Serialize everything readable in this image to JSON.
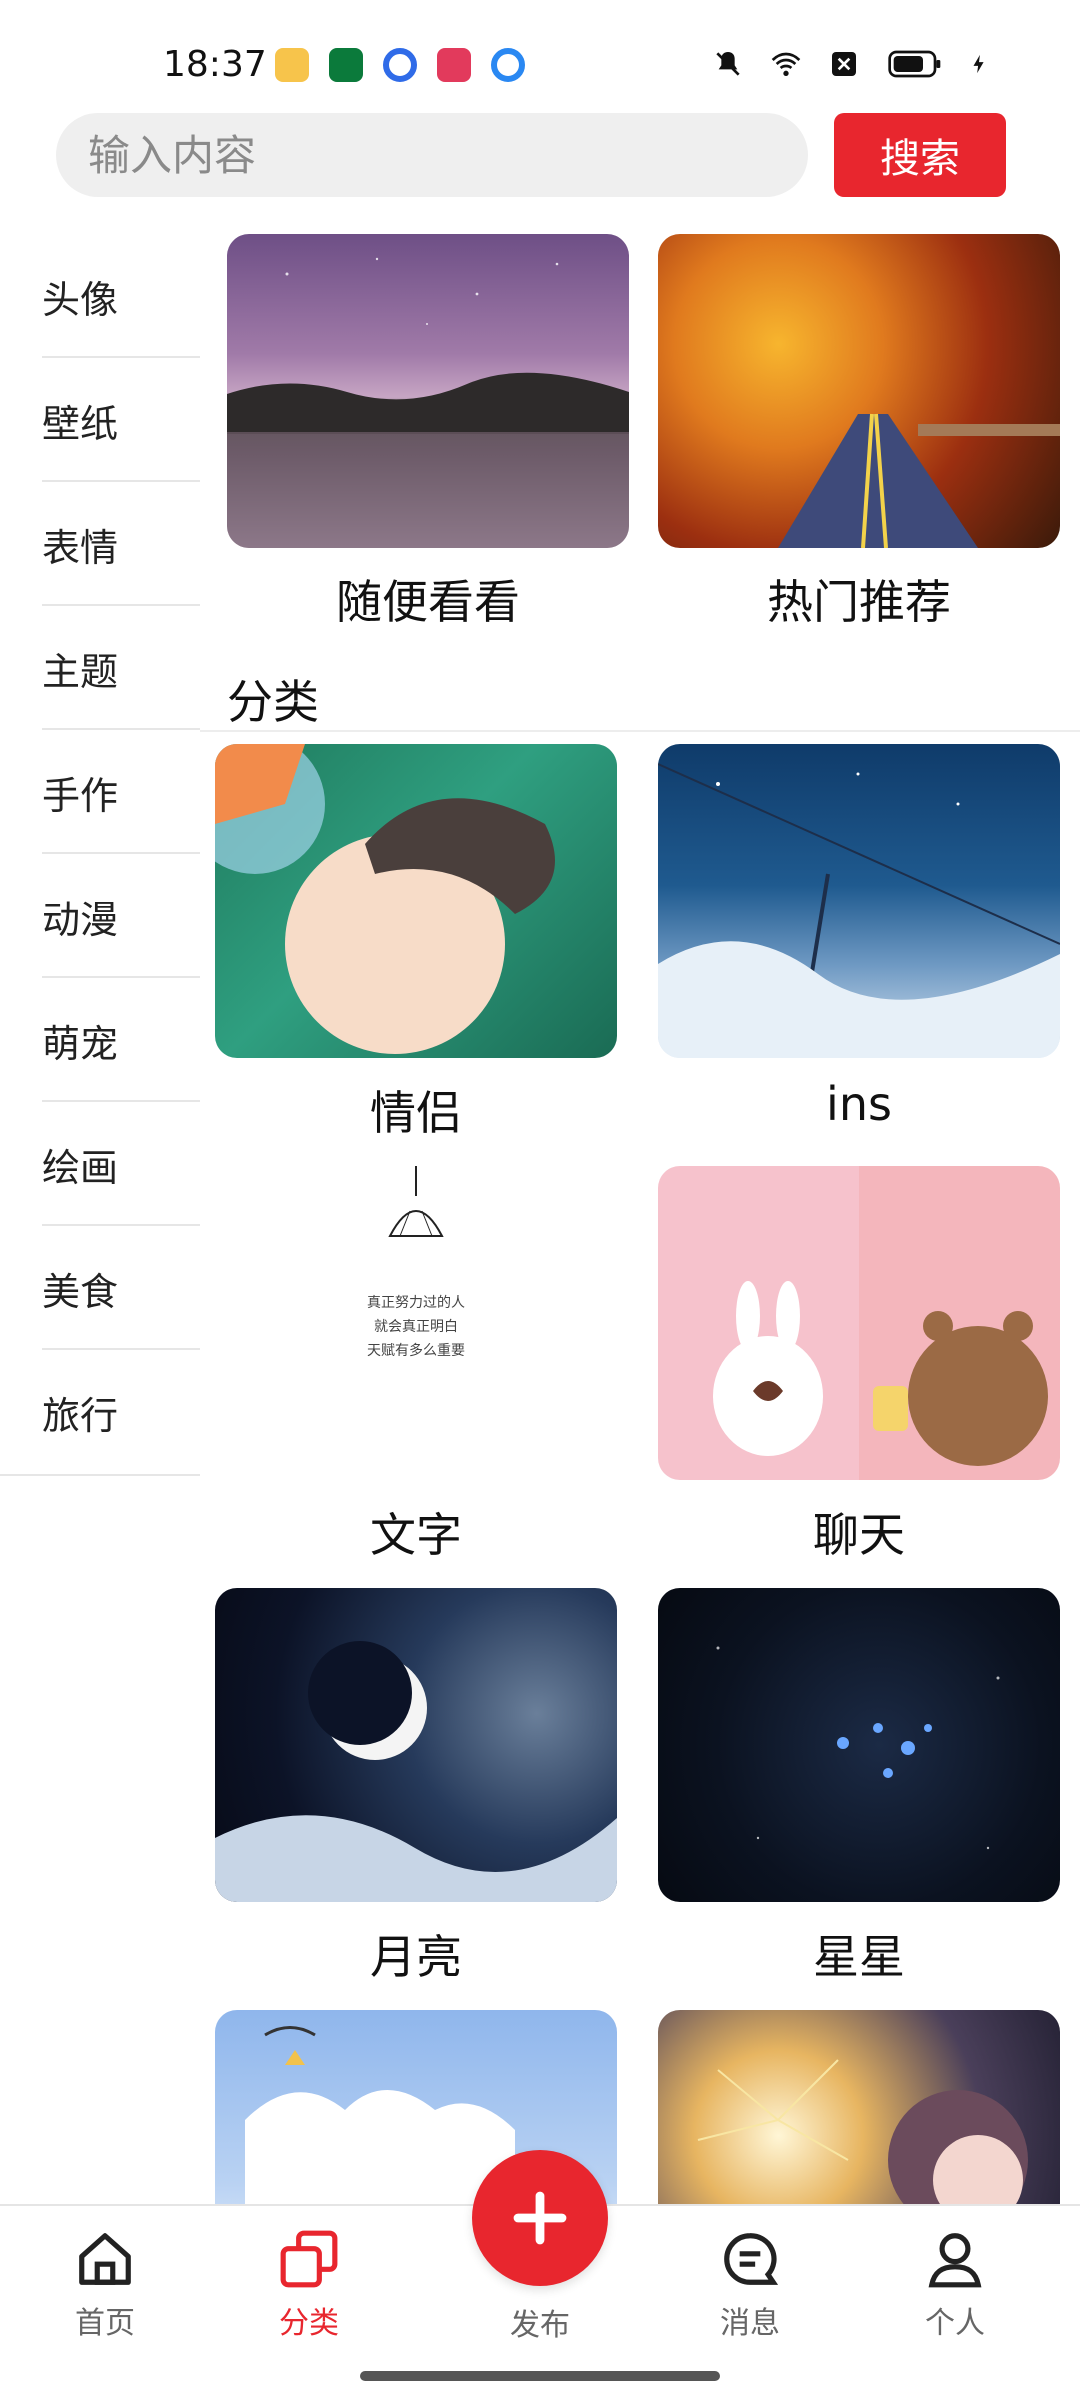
{
  "status_bar": {
    "time": "18:37",
    "notification_icons": [
      "weibo-icon",
      "oppo-icon",
      "blue-dot-app-icon",
      "video-play-icon",
      "blue-dot-app-icon-2"
    ],
    "system_icons": [
      "mute-bell-icon",
      "wifi-icon",
      "sim-x-icon",
      "battery-icon",
      "charging-bolt-icon"
    ]
  },
  "search": {
    "placeholder": "输入内容",
    "button_label": "搜索"
  },
  "sidebar": {
    "items": [
      {
        "label": "头像"
      },
      {
        "label": "壁纸"
      },
      {
        "label": "表情"
      },
      {
        "label": "主题"
      },
      {
        "label": "手作"
      },
      {
        "label": "动漫"
      },
      {
        "label": "萌宠"
      },
      {
        "label": "绘画"
      },
      {
        "label": "美食"
      },
      {
        "label": "旅行"
      }
    ]
  },
  "featured": [
    {
      "label": "随便看看",
      "image": "lake-night-sky"
    },
    {
      "label": "热门推荐",
      "image": "autumn-road"
    }
  ],
  "categories_section": {
    "title": "分类",
    "items": [
      {
        "label": "情侣",
        "image": "anime-boy-ponyo"
      },
      {
        "label": "ins",
        "image": "starry-sky-power-lines"
      },
      {
        "label": "文字",
        "image": "lamp-with-text",
        "image_text": [
          "真正努力过的人",
          "就会真正明白",
          "天赋有多么重要"
        ]
      },
      {
        "label": "聊天",
        "image": "bunny-and-bear"
      },
      {
        "label": "月亮",
        "image": "crescent-moon-clouds"
      },
      {
        "label": "星星",
        "image": "blue-star-cluster"
      },
      {
        "label": "",
        "image": "clouds-illustration"
      },
      {
        "label": "",
        "image": "fireworks-anime-girl"
      }
    ]
  },
  "bottom_nav": {
    "items": [
      {
        "label": "首页",
        "icon": "home-icon",
        "active": false
      },
      {
        "label": "分类",
        "icon": "category-icon",
        "active": true
      },
      {
        "label": "消息",
        "icon": "message-icon",
        "active": false
      },
      {
        "label": "个人",
        "icon": "profile-icon",
        "active": false
      }
    ],
    "publish": {
      "label": "发布",
      "icon": "plus-icon"
    }
  },
  "colors": {
    "accent": "#e8262e",
    "search_bg": "#efefef",
    "divider": "#e6e6e6"
  }
}
